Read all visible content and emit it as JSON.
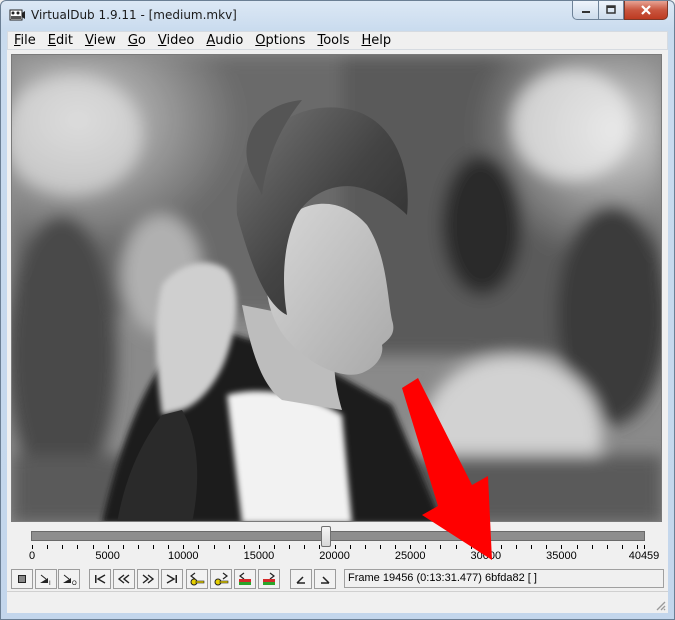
{
  "window": {
    "title": "VirtualDub 1.9.11 - [medium.mkv]"
  },
  "menu": [
    {
      "first": "F",
      "rest": "ile"
    },
    {
      "first": "E",
      "rest": "dit"
    },
    {
      "first": "V",
      "rest": "iew"
    },
    {
      "first": "G",
      "rest": "o"
    },
    {
      "first": "V",
      "rest": "ideo"
    },
    {
      "first": "A",
      "rest": "udio"
    },
    {
      "first": "O",
      "rest": "ptions"
    },
    {
      "first": "T",
      "rest": "ools"
    },
    {
      "first": "H",
      "rest": "elp"
    }
  ],
  "timeline": {
    "min": 0,
    "max": 40459,
    "current_frame": 19456,
    "tick_labels": [
      "0",
      "5000",
      "10000",
      "15000",
      "20000",
      "25000",
      "30000",
      "35000",
      "40459"
    ]
  },
  "status": {
    "frame_text": "Frame 19456 (0:13:31.477) 6bfda82 [ ]"
  },
  "toolbar_icons": [
    "stop-icon",
    "play-input-icon",
    "play-output-icon",
    "go-start-icon",
    "prev-frame-icon",
    "next-frame-icon",
    "go-end-icon",
    "prev-keyframe-icon",
    "next-keyframe-icon",
    "prev-scene-icon",
    "next-scene-icon",
    "mark-in-icon",
    "mark-out-icon"
  ],
  "colors": {
    "annotation_arrow": "#ff0000",
    "close_button": "#c9563f"
  }
}
